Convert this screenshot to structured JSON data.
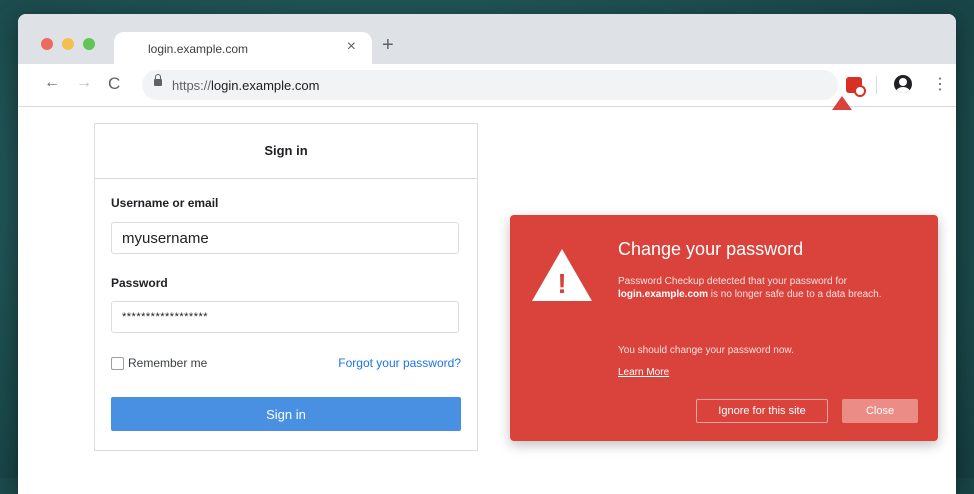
{
  "browser": {
    "tab_title": "login.example.com",
    "tab_close": "×",
    "new_tab": "+",
    "url_scheme": "https://",
    "url_host": "login.example.com",
    "menu": "⋮",
    "nav_back": "←",
    "nav_forward": "→",
    "nav_reload": "C"
  },
  "signin": {
    "header": "Sign in",
    "username_label": "Username or email",
    "username_value": "myusername",
    "password_label": "Password",
    "password_value": "******************",
    "remember_label": "Remember me",
    "forgot_link": "Forgot your password?",
    "submit_label": "Sign in"
  },
  "alert": {
    "title": "Change your password",
    "body_prefix": "Password Checkup detected that your password for ",
    "body_site": "login.example.com",
    "body_suffix": " is no longer safe due to a data breach.",
    "advice": "You should change your password now.",
    "learn_more": "Learn More",
    "ignore_label": "Ignore for this site",
    "close_label": "Close",
    "warning_glyph": "!"
  },
  "colors": {
    "alert_red": "#d9433c",
    "signin_blue": "#4a90e2",
    "link_blue": "#1a73e8"
  }
}
